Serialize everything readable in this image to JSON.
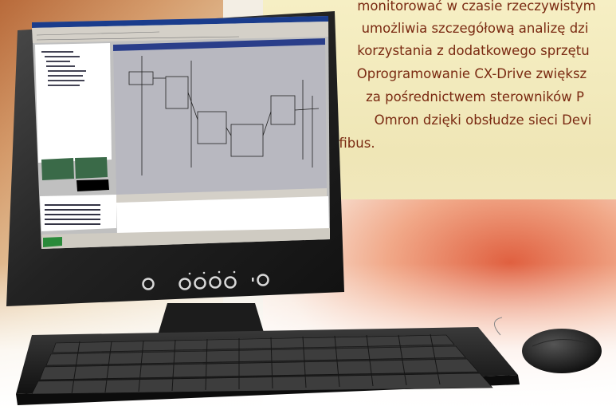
{
  "article": {
    "lines": [
      "monitorować w czasie rzeczywistym",
      "umożliwia szczegółową analizę dzi",
      "korzystania z dodatkowego sprzętu",
      "Oprogramowanie CX-Drive zwiększ",
      "za pośrednictwem sterowników P",
      "Omron dzięki obsłudze sieci Devi",
      "i Profibus."
    ]
  },
  "colors": {
    "text": "#7a2a12",
    "monitor_body": "#2a2a2a",
    "screen_gray": "#c0c0c0",
    "title_bar": "#1a3c8c"
  },
  "icons": [
    "monitor",
    "keyboard",
    "mouse",
    "power-button"
  ]
}
